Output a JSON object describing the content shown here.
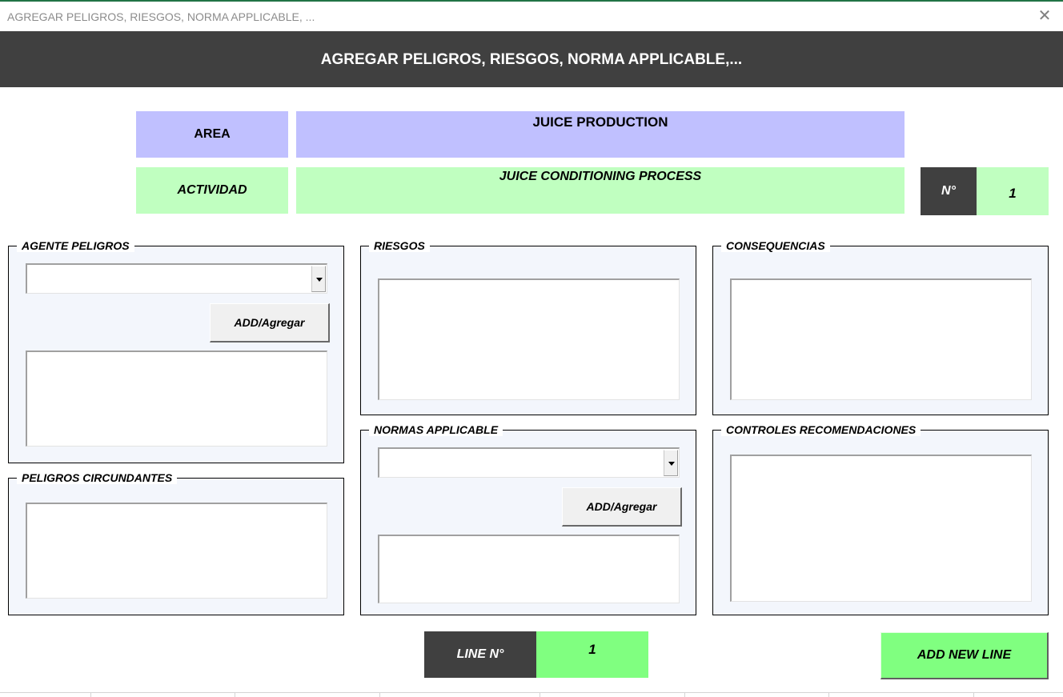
{
  "window": {
    "title": "AGREGAR PELIGROS, RIESGOS, NORMA APPLICABLE, ...",
    "close_glyph": "✕"
  },
  "banner": {
    "text": "AGREGAR PELIGROS, RIESGOS, NORMA APPLICABLE,..."
  },
  "header": {
    "area_label": "AREA",
    "area_value": "JUICE PRODUCTION",
    "actividad_label": "ACTIVIDAD",
    "actividad_value": "JUICE CONDITIONING PROCESS",
    "number_label": "N°",
    "number_value": "1"
  },
  "agente_peligros": {
    "caption": "AGENTE PELIGROS",
    "combo_value": "",
    "add_label": "ADD/Agregar",
    "list_value": ""
  },
  "peligros_circundantes": {
    "caption": "PELIGROS CIRCUNDANTES",
    "value": ""
  },
  "riesgos": {
    "caption": "RIESGOS",
    "value": ""
  },
  "normas": {
    "caption": "NORMAS APPLICABLE",
    "combo_value": "",
    "add_label": "ADD/Agregar",
    "list_value": ""
  },
  "consequencias": {
    "caption": "CONSEQUENCIAS",
    "value": ""
  },
  "controles": {
    "caption": "CONTROLES RECOMENDACIONES",
    "value": ""
  },
  "footer": {
    "line_label": "LINE N°",
    "line_value": "1",
    "add_new_line_label": "ADD NEW LINE"
  },
  "colors": {
    "area_bg": "#c0c0ff",
    "actividad_bg": "#c0ffc0",
    "dark_bg": "#404040",
    "green_button": "#80ff80",
    "frame_bg": "#f3f6fc"
  },
  "icons": {
    "close": "close-icon",
    "dropdown": "chevron-down-icon"
  }
}
